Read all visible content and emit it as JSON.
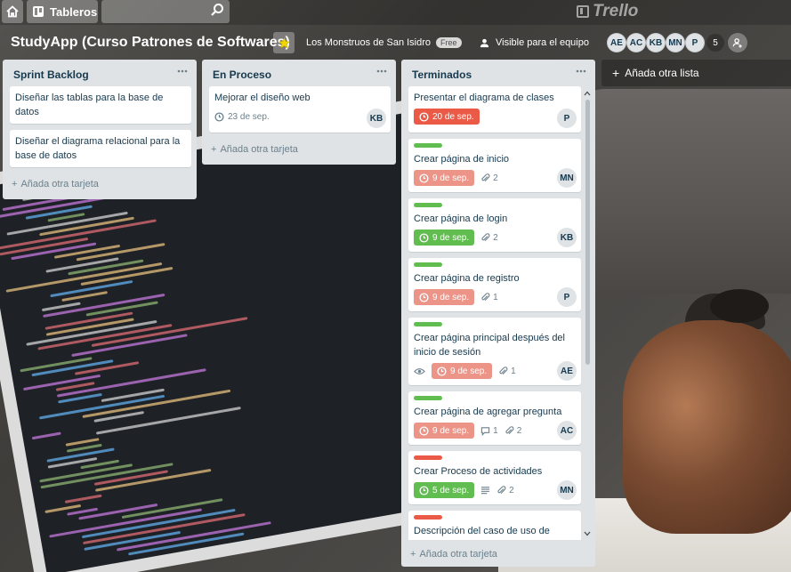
{
  "topbar": {
    "boards_label": "Tableros",
    "search_placeholder": "",
    "logo_text": "Trello"
  },
  "board": {
    "title": "StudyApp (Curso Patrones de Softwares)",
    "team_name": "Los Monstruos de San Isidro",
    "team_badge": "Free",
    "visibility": "Visible para el equipo",
    "members": [
      "AE",
      "AC",
      "KB",
      "MN",
      "P"
    ],
    "member_count": "5"
  },
  "colors": {
    "label_green": "#61bd4f",
    "label_red": "#eb5a46",
    "due_overdue": "#eb5a46",
    "due_past": "#ec9488",
    "due_complete": "#61bd4f",
    "list_bg": "#dfe3e6"
  },
  "lists": [
    {
      "title": "Sprint Backlog",
      "cards": [
        {
          "title": "Diseñar las tablas para la base de datos"
        },
        {
          "title": "Diseñar el diagrama relacional para la base de datos"
        }
      ],
      "add_card": "Añada otra tarjeta"
    },
    {
      "title": "En Proceso",
      "cards": [
        {
          "title": "Mejorar el diseño web",
          "due": "23 de sep.",
          "member": "KB"
        }
      ],
      "add_card": "Añada otra tarjeta"
    },
    {
      "title": "Terminados",
      "cards": [
        {
          "title": "Presentar el diagrama de clases",
          "due": "20 de sep.",
          "member": "P"
        },
        {
          "title": "Crear página de inicio",
          "label": "green",
          "due": "9 de sep.",
          "attachments": "2",
          "member": "MN"
        },
        {
          "title": "Crear página de login",
          "label": "green",
          "due": "9 de sep.",
          "attachments": "2",
          "member": "KB"
        },
        {
          "title": "Crear página de registro",
          "label": "green",
          "due": "9 de sep.",
          "attachments": "1",
          "member": "P"
        },
        {
          "title": "Crear página principal después del inicio de sesión",
          "label": "green",
          "due": "9 de sep.",
          "attachments": "1",
          "member": "AE"
        },
        {
          "title": "Crear página de agregar pregunta",
          "label": "green",
          "due": "9 de sep.",
          "comments": "1",
          "attachments": "2",
          "member": "AC"
        },
        {
          "title": "Crear Proceso de actividades",
          "label": "red",
          "due": "5 de sep.",
          "attachments": "2",
          "member": "MN"
        },
        {
          "title": "Descripción del caso de uso de",
          "label": "red"
        }
      ],
      "add_card": "Añada otra tarjeta"
    }
  ],
  "add_list": "Añada otra lista"
}
